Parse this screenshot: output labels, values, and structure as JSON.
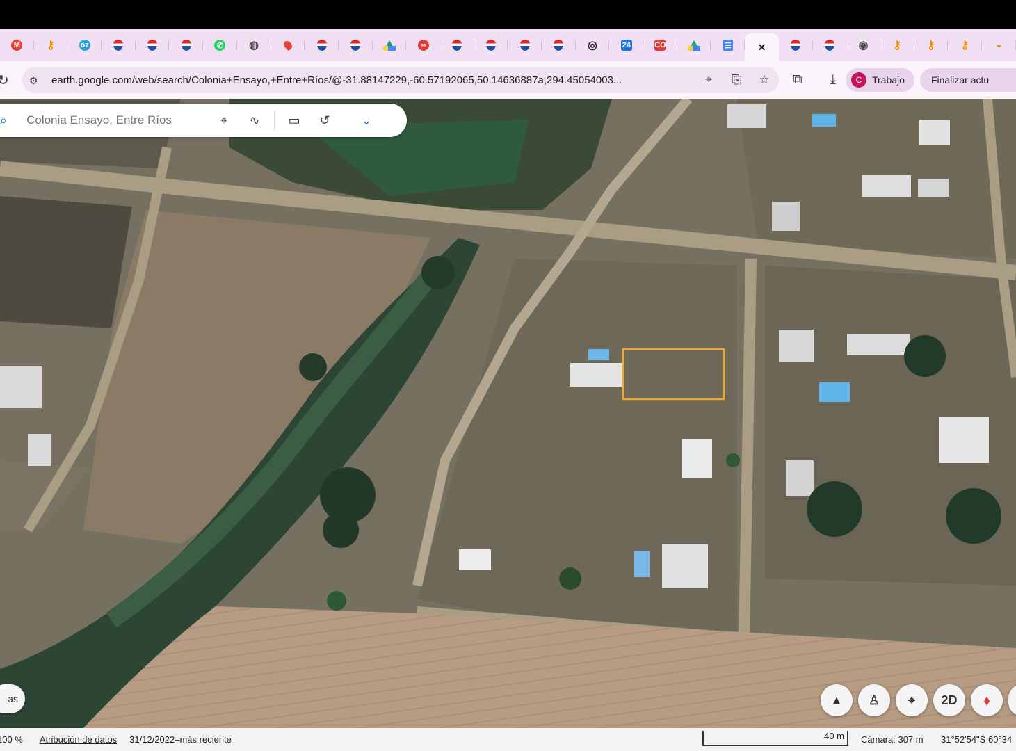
{
  "browser": {
    "new_tab_label": "+",
    "close_tab_label": "×",
    "tabs": [
      {
        "icon": "gmail-icon",
        "letter": "M",
        "color": "#ea4335"
      },
      {
        "icon": "orange-key-icon",
        "letter": "⚷",
        "color": "#f08a00"
      },
      {
        "icon": "oz-icon",
        "letter": "oz",
        "color": "#29a3e0"
      },
      {
        "icon": "remax-balloon-icon"
      },
      {
        "icon": "remax-balloon-icon"
      },
      {
        "icon": "remax-balloon-icon"
      },
      {
        "icon": "whatsapp-icon",
        "letter": "✆",
        "color": "#25d366"
      },
      {
        "icon": "globe-icon",
        "letter": "◍",
        "color": "#555"
      },
      {
        "icon": "maps-pin-icon"
      },
      {
        "icon": "remax-balloon-icon"
      },
      {
        "icon": "remax-balloon-icon"
      },
      {
        "icon": "google-drive-icon"
      },
      {
        "icon": "link-icon",
        "letter": "∞",
        "color": "#e53935"
      },
      {
        "icon": "remax-balloon-icon"
      },
      {
        "icon": "remax-balloon-icon"
      },
      {
        "icon": "remax-balloon-icon"
      },
      {
        "icon": "remax-balloon-icon"
      },
      {
        "icon": "target-icon",
        "letter": "◎",
        "color": "#222"
      },
      {
        "icon": "calendar-icon",
        "letter": "24",
        "color": "#1a73e8"
      },
      {
        "icon": "co-icon",
        "letter": "CO",
        "color": "#e53935"
      },
      {
        "icon": "google-drive-icon"
      },
      {
        "icon": "google-docs-icon"
      },
      {
        "icon": "close-icon",
        "active": true
      },
      {
        "icon": "remax-balloon-icon"
      },
      {
        "icon": "remax-balloon-icon"
      },
      {
        "icon": "chrome-icon",
        "letter": "◉",
        "color": "#555"
      },
      {
        "icon": "orange-key-icon",
        "letter": "⚷",
        "color": "#f08a00"
      },
      {
        "icon": "orange-key-icon",
        "letter": "⚷",
        "color": "#f08a00"
      },
      {
        "icon": "orange-key-icon",
        "letter": "⚷",
        "color": "#f08a00"
      },
      {
        "icon": "bowl-icon",
        "letter": "◒",
        "color": "#c9a227"
      }
    ],
    "url": "earth.google.com/web/search/Colonia+Ensayo,+Entre+Ríos/@-31.88147229,-60.57192065,50.14636887a,294.45054003...",
    "profile_initial": "C",
    "profile_name": "Trabajo",
    "update_label": "Finalizar actu"
  },
  "search": {
    "placeholder": "Colonia Ensayo, Entre Ríos"
  },
  "toolbar": {
    "icons": [
      "place-pin-icon",
      "path-icon",
      "ruler-icon",
      "history-icon",
      "chevron-down-icon"
    ]
  },
  "map_controls": {
    "layers_label": "as",
    "mode_2d": "2D"
  },
  "status": {
    "zoom": "100 %",
    "attribution": "Atribución de datos",
    "imagery_date": "31/12/2022–más reciente",
    "scale": "40 m",
    "camera": "Cámara: 307 m",
    "coordinates": "31°52'54\"S 60°34"
  },
  "colors": {
    "tab_strip": "#f1dff3",
    "selection_outline": "#f5a623",
    "accent": "#1a73e8"
  }
}
